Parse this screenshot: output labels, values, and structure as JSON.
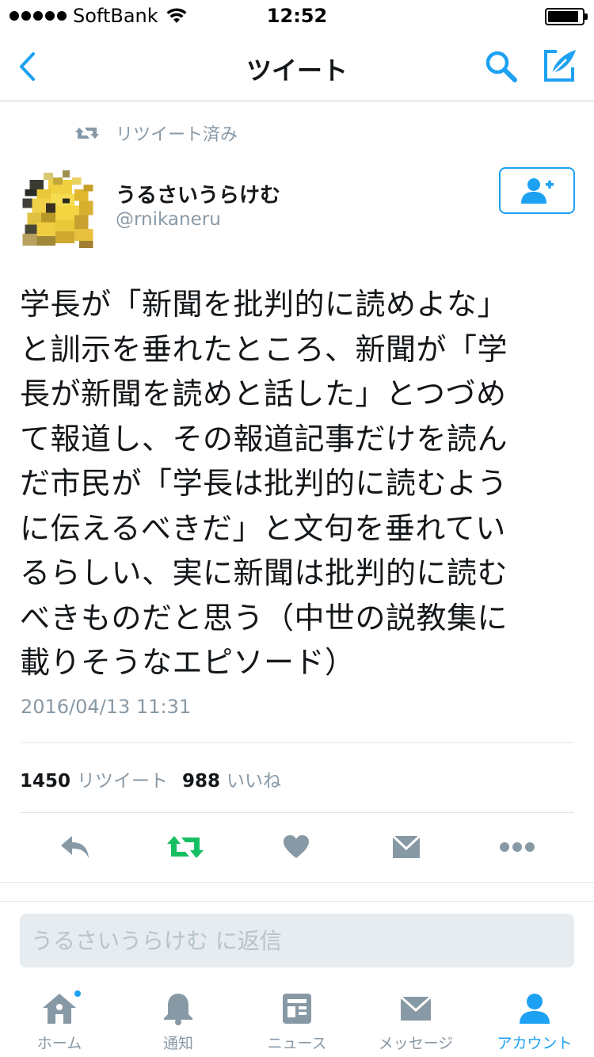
{
  "status_bar": {
    "carrier": "SoftBank",
    "time": "12:52",
    "battery_level": 0.92
  },
  "nav": {
    "title": "ツイート",
    "back_icon": "chevron-left-icon",
    "search_icon": "search-icon",
    "compose_icon": "compose-quill-icon"
  },
  "retweet_note": {
    "label": "リツイート済み",
    "icon": "retweet-icon"
  },
  "author": {
    "name": "うるさいうらけむ",
    "handle": "@rnikaneru",
    "follow_icon": "add-user-icon"
  },
  "tweet": {
    "lines": [
      "学長が「新聞を批判的に読めよな」",
      "と訓示を垂れたところ、新聞が「学",
      "長が新聞を読めと話した」とつづめ",
      "て報道し、その報道記事だけを読ん",
      "だ市民が「学長は批判的に読むよう",
      "に伝えるべきだ」と文句を垂れてい",
      "るらしい、実に新聞は批判的に読む",
      "べきものだと思う（中世の説教集に",
      "載りそうなエピソード）"
    ],
    "timestamp": "2016/04/13 11:31"
  },
  "stats": {
    "retweet_count": "1450",
    "retweet_label": "リツイート",
    "like_count": "988",
    "like_label": "いいね"
  },
  "actions": {
    "reply_icon": "reply-icon",
    "retweet_icon": "retweet-icon",
    "like_icon": "heart-icon",
    "dm_icon": "envelope-icon",
    "more_icon": "more-dots-icon"
  },
  "reply": {
    "placeholder": "うるさいうらけむ に返信"
  },
  "tab_bar": {
    "items": [
      {
        "label": "ホーム",
        "icon": "home-icon"
      },
      {
        "label": "通知",
        "icon": "bell-icon"
      },
      {
        "label": "ニュース",
        "icon": "news-icon"
      },
      {
        "label": "メッセージ",
        "icon": "envelope-icon"
      },
      {
        "label": "アカウント",
        "icon": "person-icon"
      }
    ],
    "active_index": 4
  },
  "colors": {
    "accent": "#1da1f2",
    "retweet_green": "#17bf63",
    "muted": "#8899a6",
    "text": "#14171a"
  }
}
